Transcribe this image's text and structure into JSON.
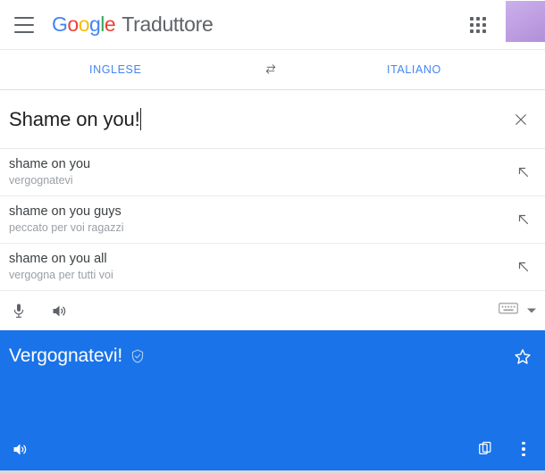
{
  "header": {
    "menu_label": "menu",
    "logo": {
      "letters": [
        "G",
        "o",
        "o",
        "g",
        "l",
        "e"
      ],
      "colors": [
        "#4285F4",
        "#EA4335",
        "#FBBC05",
        "#4285F4",
        "#34A853",
        "#EA4335"
      ]
    },
    "product_name": "Traduttore",
    "apps_label": "Google apps",
    "avatar_label": "account"
  },
  "languages": {
    "source": "INGLESE",
    "target": "ITALIANO",
    "swap_label": "swap languages"
  },
  "input": {
    "value": "Shame on you!",
    "clear_label": "×"
  },
  "suggestions": [
    {
      "term": "shame on you",
      "translation": "vergognatevi"
    },
    {
      "term": "shame on you guys",
      "translation": "peccato per voi ragazzi"
    },
    {
      "term": "shame on you all",
      "translation": "vergogna per tutti voi"
    }
  ],
  "source_toolbar": {
    "mic_label": "microphone",
    "listen_label": "listen",
    "keyboard_label": "keyboard",
    "keyboard_caret_label": "keyboard options"
  },
  "result": {
    "text": "Vergognatevi!",
    "verified_label": "verified translation",
    "star_label": "save translation",
    "listen_label": "listen",
    "copy_label": "copy translation",
    "more_label": "more options"
  },
  "colors": {
    "accent_blue": "#1a73e8",
    "link_blue": "#4285F4",
    "muted_text": "#9aa0a6",
    "avatar_purple": "#bd9ce0"
  }
}
